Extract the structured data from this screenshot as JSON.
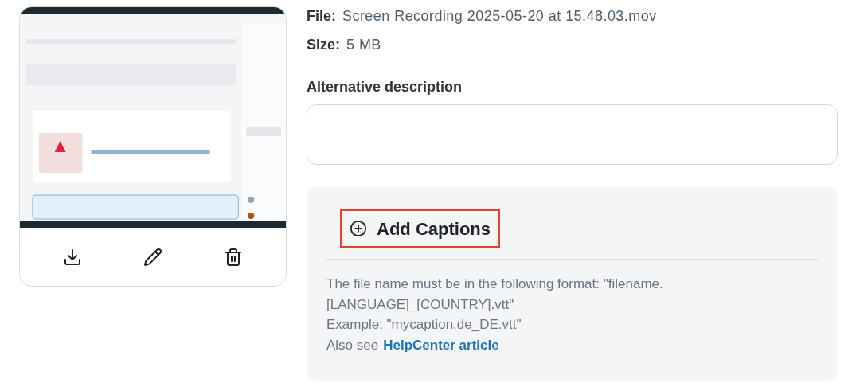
{
  "actions": [
    {
      "kind": "download"
    },
    {
      "kind": "edit"
    },
    {
      "kind": "delete"
    }
  ],
  "file": {
    "label": "File:",
    "value": "Screen Recording 2025-05-20 at 15.48.03.mov"
  },
  "size": {
    "label": "Size:",
    "value": "5 MB"
  },
  "alt_description": {
    "label": "Alternative description"
  },
  "captions": {
    "button": "Add Captions",
    "focused": true,
    "help": [
      "The file name must be in the following format: \"filename.",
      "[LANGUAGE]_[COUNTRY].vtt\"",
      "Example: \"mycaption.de_DE.vtt\""
    ],
    "see_also": "Also see",
    "link": "HelpCenter article"
  }
}
